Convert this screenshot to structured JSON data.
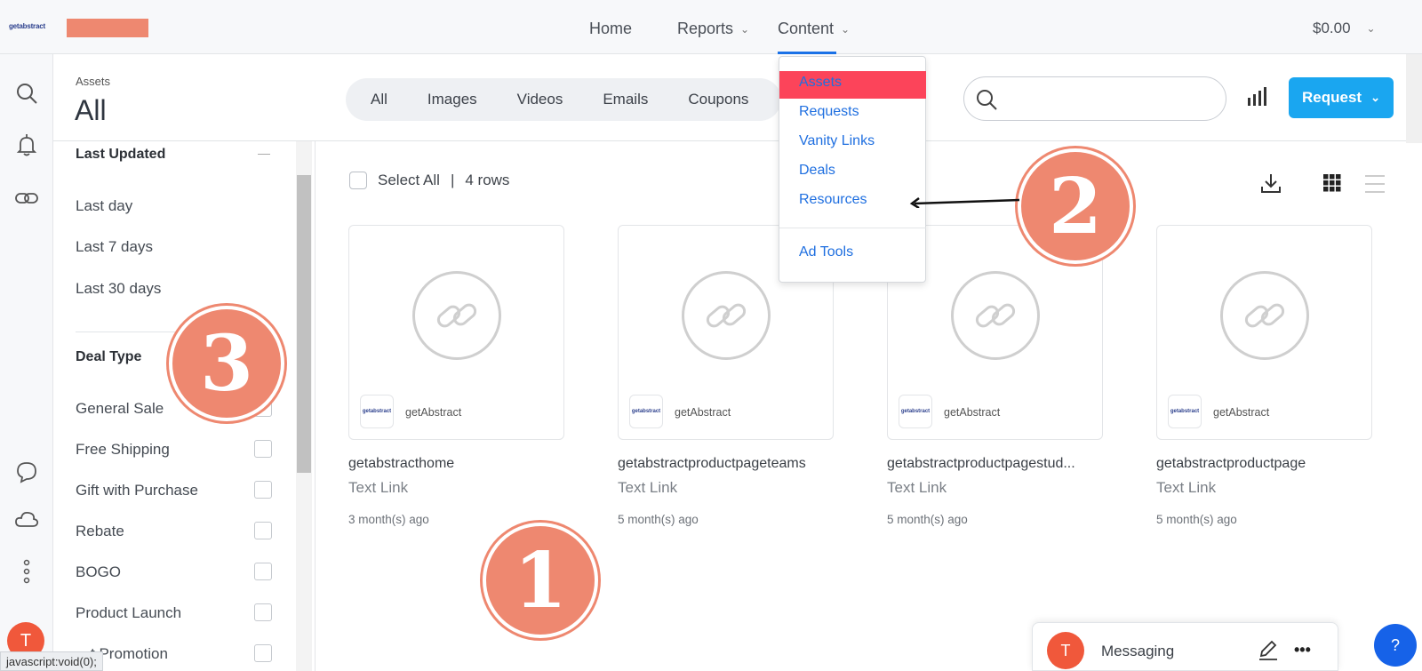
{
  "topbar": {
    "logo": "getabstract",
    "nav": [
      {
        "label": "Home",
        "has_chevron": false
      },
      {
        "label": "Reports",
        "has_chevron": true
      },
      {
        "label": "Content",
        "has_chevron": true
      }
    ],
    "balance": "$0.00"
  },
  "header": {
    "breadcrumb": "Assets",
    "title": "All",
    "tabs": [
      "All",
      "Images",
      "Videos",
      "Emails",
      "Coupons"
    ],
    "search_placeholder": "",
    "request_label": "Request"
  },
  "dropdown": {
    "items": [
      "Assets",
      "Requests",
      "Vanity Links",
      "Deals",
      "Resources"
    ],
    "active": "Assets",
    "extra_item": "Ad Tools"
  },
  "filters": {
    "last_updated": {
      "heading": "Last Updated",
      "options": [
        "Last day",
        "Last 7 days",
        "Last 30 days"
      ]
    },
    "deal_type": {
      "heading": "Deal Type",
      "options": [
        "General Sale",
        "Free Shipping",
        "Gift with Purchase",
        "Rebate",
        "BOGO",
        "Product Launch",
        "…t Promotion"
      ]
    }
  },
  "content": {
    "select_all": "Select All",
    "separator": "|",
    "row_count": "4 rows",
    "cards": [
      {
        "brand_logo": "getabstract",
        "brand": "getAbstract",
        "title": "getabstracthome",
        "type": "Text Link",
        "age": "3 month(s) ago"
      },
      {
        "brand_logo": "getabstract",
        "brand": "getAbstract",
        "title": "getabstractproductpageteams",
        "type": "Text Link",
        "age": "5 month(s) ago"
      },
      {
        "brand_logo": "getabstract",
        "brand": "getAbstract",
        "title": "getabstractproductpagestud...",
        "type": "Text Link",
        "age": "5 month(s) ago"
      },
      {
        "brand_logo": "getabstract",
        "brand": "getAbstract",
        "title": "getabstractproductpage",
        "type": "Text Link",
        "age": "5 month(s) ago"
      }
    ]
  },
  "annotations": {
    "step1": "1",
    "step2": "2",
    "step3": "3"
  },
  "user": {
    "initial": "T"
  },
  "messaging": {
    "initial": "T",
    "label": "Messaging",
    "more": "•••"
  },
  "help": {
    "label": "?"
  },
  "status_bar": "javascript:void(0);",
  "colors": {
    "accent_blue": "#1aa6f0",
    "link_blue": "#1f6fe0",
    "active_red": "#fc445a",
    "badge": "#ee8870",
    "avatar": "#f0583b"
  }
}
